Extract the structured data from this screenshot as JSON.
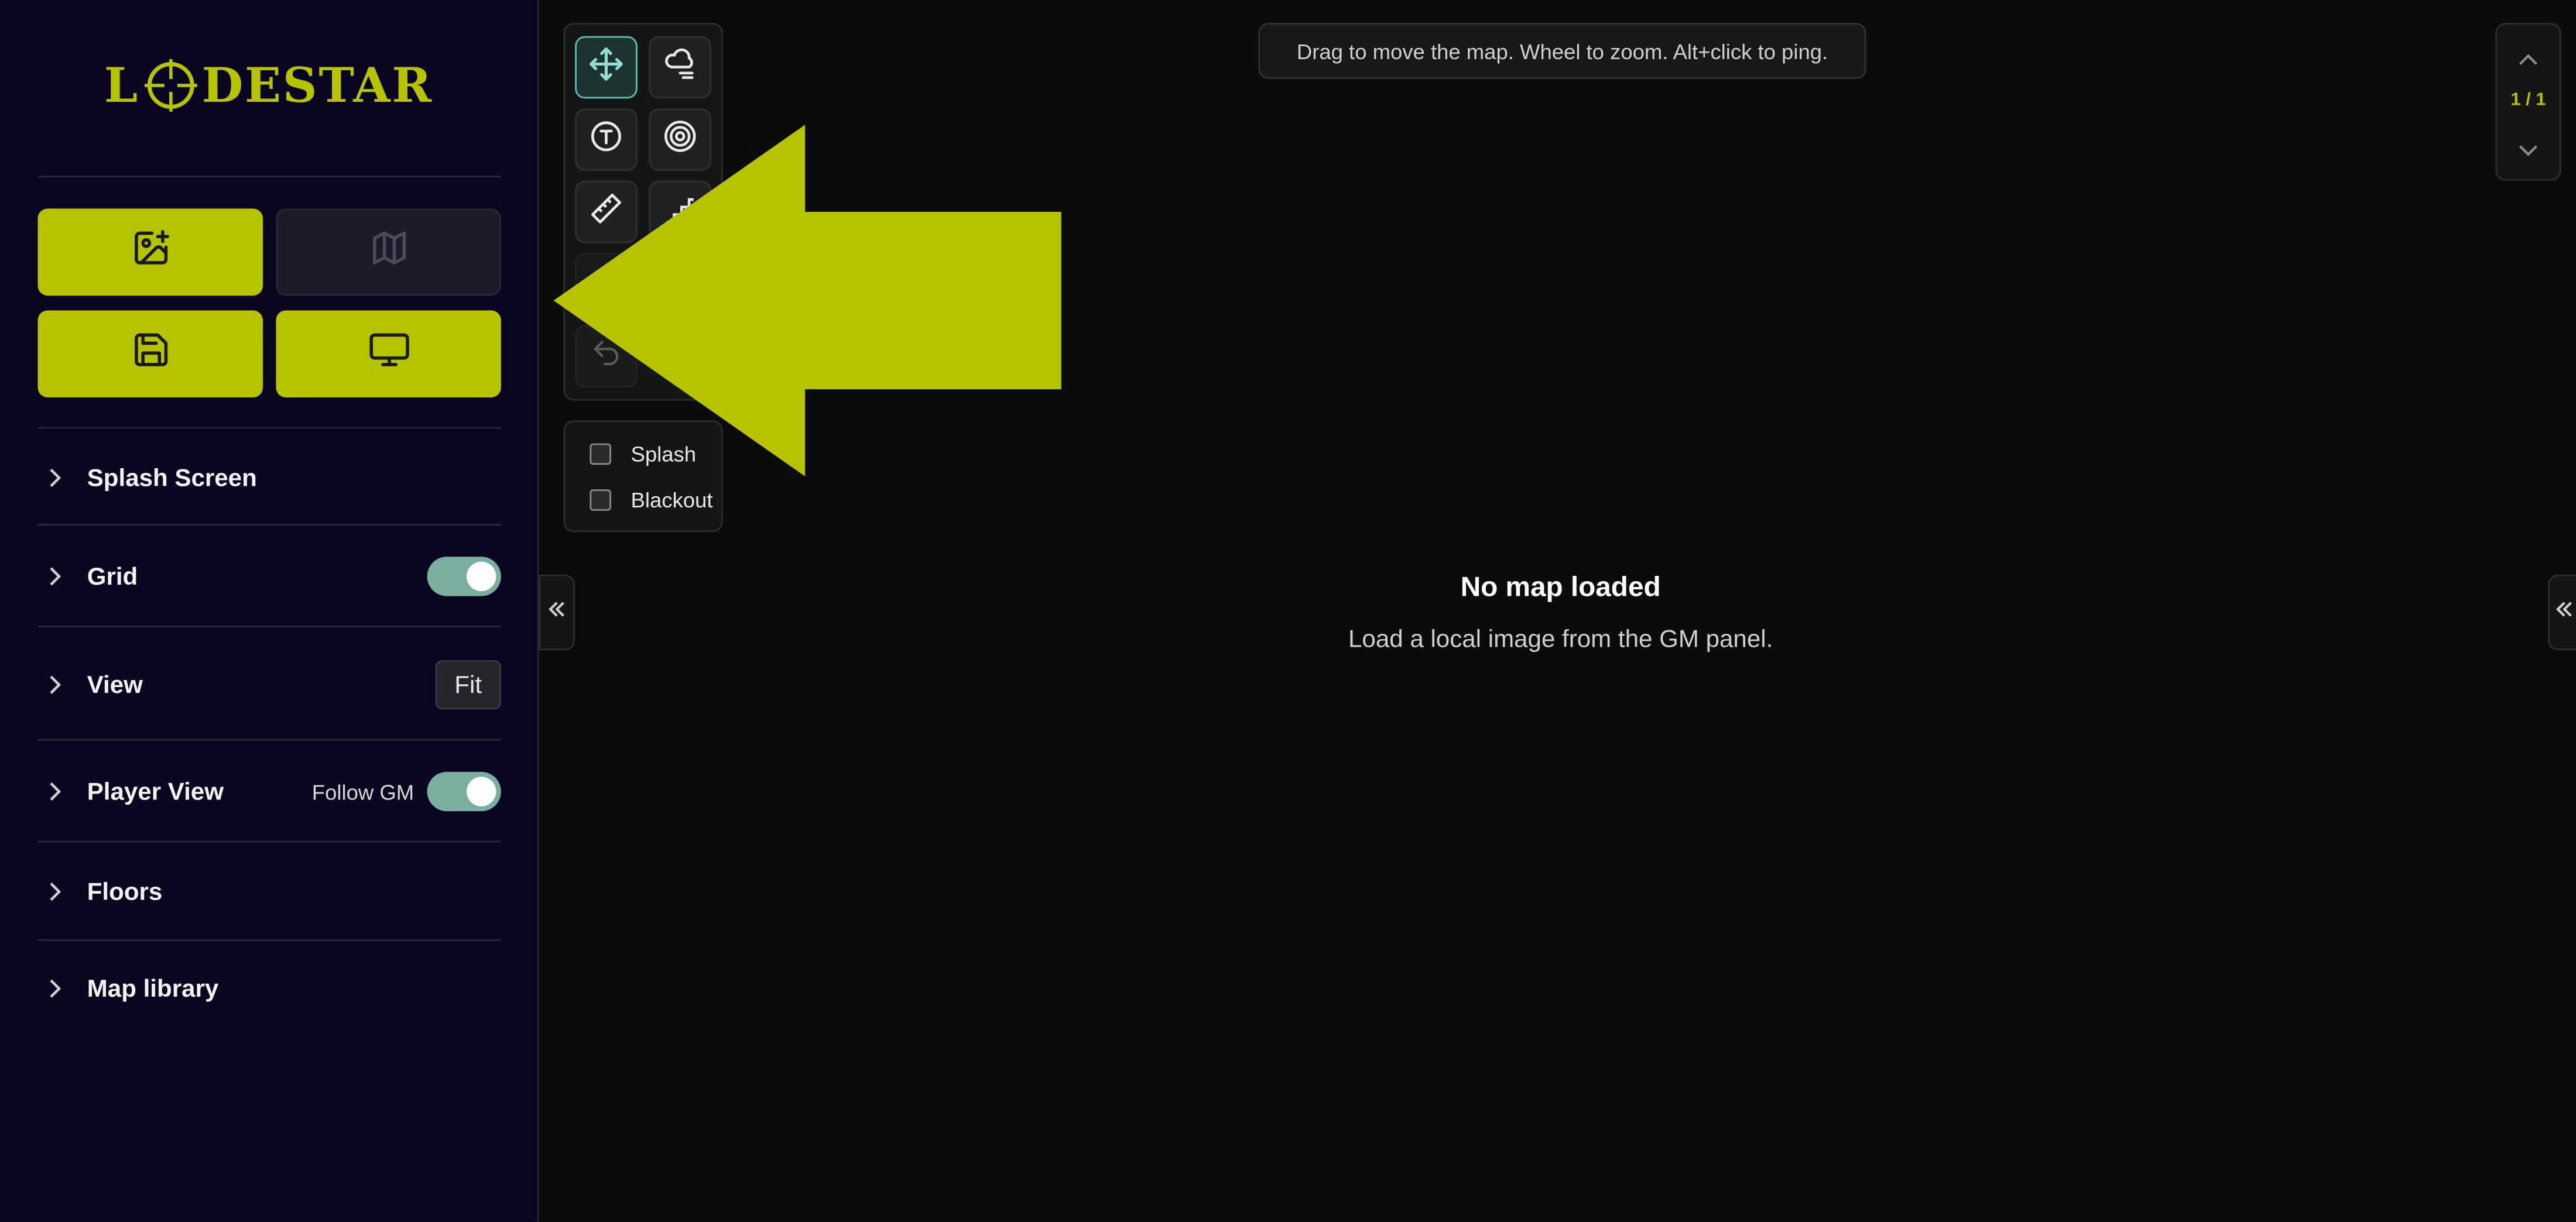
{
  "brand": {
    "logo_text_left": "L",
    "logo_text_right": "DESTAR",
    "color": "#b5c300"
  },
  "colors": {
    "accent": "#b5c300",
    "toggle_on": "#7aae9e",
    "active_tool": "#5fbfaf",
    "sidebar_bg": "#0a0620",
    "canvas_bg": "#0a0b0b"
  },
  "sidebar": {
    "actions": [
      {
        "icon": "image-plus-icon"
      },
      {
        "icon": "map-icon"
      },
      {
        "icon": "save-icon"
      },
      {
        "icon": "monitor-icon"
      }
    ],
    "sections": {
      "splash": {
        "label": "Splash Screen"
      },
      "grid": {
        "label": "Grid",
        "toggle": true
      },
      "view": {
        "label": "View",
        "button": "Fit"
      },
      "player_view": {
        "label": "Player View",
        "follow_label": "Follow GM",
        "toggle": true
      },
      "floors": {
        "label": "Floors"
      },
      "map_library": {
        "label": "Map library"
      }
    }
  },
  "tools": [
    {
      "icon": "move-icon",
      "active": true
    },
    {
      "icon": "fog-cloud-icon"
    },
    {
      "icon": "token-icon"
    },
    {
      "icon": "target-icon"
    },
    {
      "icon": "ruler-icon"
    },
    {
      "icon": "stairs-icon"
    },
    {
      "icon": "undo-icon"
    }
  ],
  "overlays": {
    "splash_label": "Splash",
    "blackout_label": "Blackout",
    "splash_checked": false,
    "blackout_checked": false
  },
  "hint": "Drag to move the map. Wheel to zoom. Alt+click to ping.",
  "empty_state": {
    "title": "No map loaded",
    "subtitle": "Load a local image from the GM panel."
  },
  "pager": {
    "text": "1 / 1"
  }
}
